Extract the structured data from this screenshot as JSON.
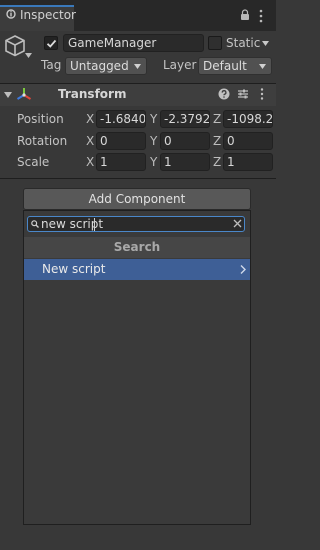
{
  "window": {
    "tab_label": "Inspector"
  },
  "header": {
    "active": true,
    "name": "GameManager",
    "static_checked": false,
    "static_label": "Static",
    "tag_label": "Tag",
    "tag_value": "Untagged",
    "layer_label": "Layer",
    "layer_value": "Default"
  },
  "transform": {
    "title": "Transform",
    "rows": [
      {
        "label": "Position",
        "x": "-1.6840",
        "y": "-2.3792",
        "z": "-1098.2"
      },
      {
        "label": "Rotation",
        "x": "0",
        "y": "0",
        "z": "0"
      },
      {
        "label": "Scale",
        "x": "1",
        "y": "1",
        "z": "1"
      }
    ],
    "axes": {
      "x": "X",
      "y": "Y",
      "z": "Z"
    }
  },
  "add_component": {
    "button_label": "Add Component",
    "search_value": "new script",
    "search_header": "Search",
    "results": [
      {
        "label": "New script",
        "selected": true
      }
    ]
  },
  "colors": {
    "selection": "#3e5f96",
    "focus_border": "#4a87c9",
    "tab_accent": "#3a79bb",
    "transform_x_axis": "#e0463b",
    "transform_y_axis": "#7cc93e",
    "transform_z_axis": "#3e7ae0"
  },
  "icons": [
    "inspector-icon",
    "lock-icon",
    "kebab-menu-icon",
    "gameobject-cube-icon",
    "checkmark-icon",
    "chevron-down-icon",
    "foldout-arrow-icon",
    "transform-icon",
    "help-icon",
    "preset-icon",
    "search-icon",
    "clear-icon",
    "chevron-right-icon"
  ]
}
